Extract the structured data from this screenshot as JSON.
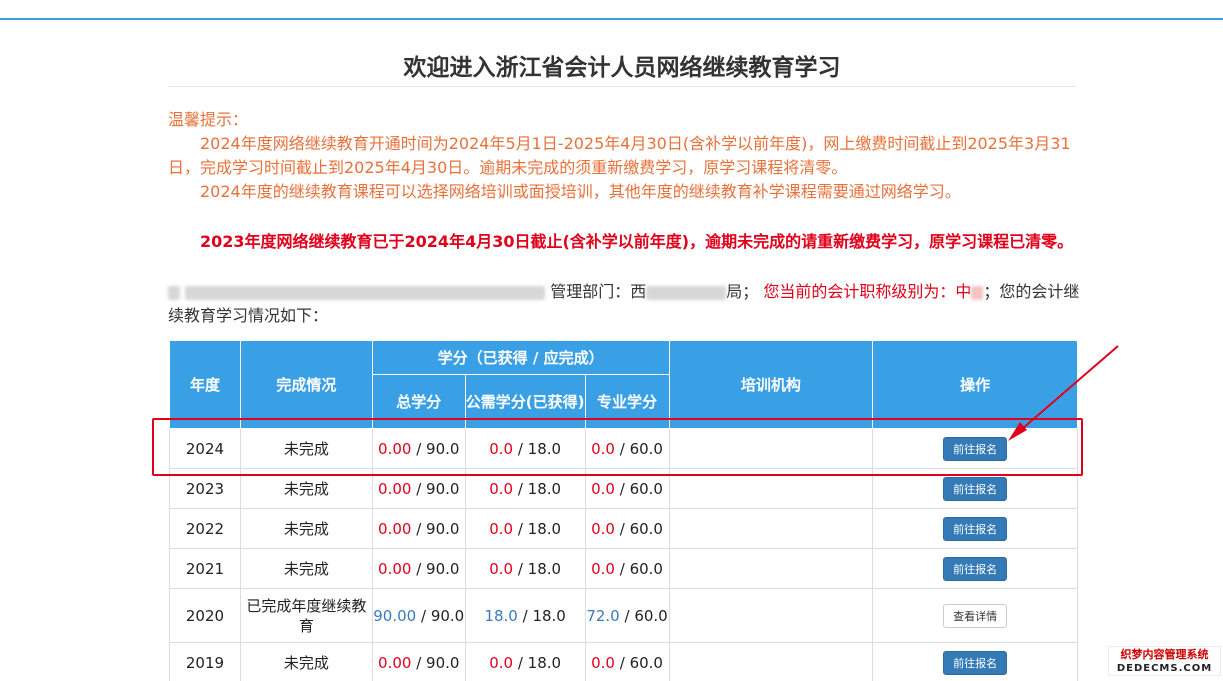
{
  "page": {
    "title": "欢迎进入浙江省会计人员网络继续教育学习"
  },
  "notice": {
    "heading": "温馨提示：",
    "line1": "2024年度网络继续教育开通时间为2024年5月1日-2025年4月30日(含补学以前年度)，网上缴费时间截止到2025年3月31日，完成学习时间截止到2025年4月30日。逾期未完成的须重新缴费学习，原学习课程将清零。",
    "line2": "2024年度的继续教育课程可以选择网络培训或面授培训，其他年度的继续教育补学课程需要通过网络学习。"
  },
  "warning": "2023年度网络继续教育已于2024年4月30日截止(含补学以前年度)，逾期未完成的请重新缴费学习，原学习课程已清零。",
  "user": {
    "dept_label": "管理部门：",
    "dept_prefix": "西",
    "dept_suffix": "局；",
    "level_label": "您当前的会计职称级别为：",
    "level_value": "中",
    "tail": "；您的会计继续教育学习情况如下："
  },
  "table": {
    "headers": {
      "year": "年度",
      "status": "完成情况",
      "credits_group": "学分（已获得 / 应完成）",
      "total": "总学分",
      "public": "公需学分(已获得)",
      "professional": "专业学分",
      "org": "培训机构",
      "action": "操作"
    },
    "rows": [
      {
        "year": "2024",
        "status": "未完成",
        "total_got": "0.00",
        "total_need": "90.0",
        "pub_got": "0.0",
        "pub_need": "18.0",
        "pro_got": "0.0",
        "pro_need": "60.0",
        "org": "",
        "action": "前往报名"
      },
      {
        "year": "2023",
        "status": "未完成",
        "total_got": "0.00",
        "total_need": "90.0",
        "pub_got": "0.0",
        "pub_need": "18.0",
        "pro_got": "0.0",
        "pro_need": "60.0",
        "org": "",
        "action": "前往报名"
      },
      {
        "year": "2022",
        "status": "未完成",
        "total_got": "0.00",
        "total_need": "90.0",
        "pub_got": "0.0",
        "pub_need": "18.0",
        "pro_got": "0.0",
        "pro_need": "60.0",
        "org": "",
        "action": "前往报名"
      },
      {
        "year": "2021",
        "status": "未完成",
        "total_got": "0.00",
        "total_need": "90.0",
        "pub_got": "0.0",
        "pub_need": "18.0",
        "pro_got": "0.0",
        "pro_need": "60.0",
        "org": "",
        "action": "前往报名"
      },
      {
        "year": "2020",
        "status": "已完成年度继续教育",
        "total_got": "90.00",
        "total_need": "90.0",
        "pub_got": "18.0",
        "pub_need": "18.0",
        "pro_got": "72.0",
        "pro_need": "60.0",
        "org": "",
        "action": "查看详情"
      },
      {
        "year": "2019",
        "status": "未完成",
        "total_got": "0.00",
        "total_need": "90.0",
        "pub_got": "0.0",
        "pub_need": "18.0",
        "pro_got": "0.0",
        "pro_need": "60.0",
        "org": "",
        "action": "前往报名"
      }
    ],
    "separator": " / "
  },
  "watermark": {
    "cn": "织梦内容管理系统",
    "en": "DEDECMS.COM"
  },
  "colors": {
    "header_blue": "#3aa0e6",
    "notice_orange": "#e8713a",
    "warning_red": "#e0001b",
    "button_blue": "#337ab7",
    "complete_blue": "#3a7abf"
  }
}
